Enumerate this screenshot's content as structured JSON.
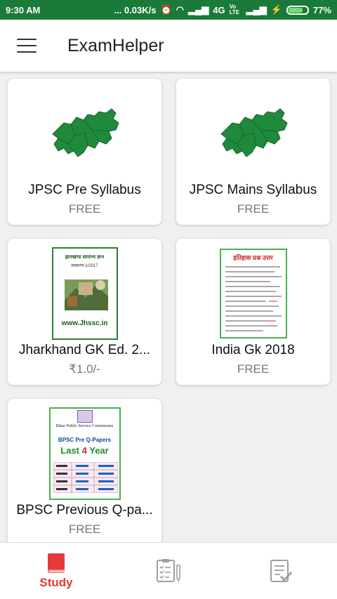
{
  "status_bar": {
    "time": "9:30 AM",
    "net_speed": "... 0.03K/s",
    "network": "4G",
    "volte": "Vo LTE",
    "battery_text": "77%",
    "battery_level": 0.77
  },
  "app_bar": {
    "title": "ExamHelper"
  },
  "cards": [
    {
      "title": "JPSC Pre Syllabus",
      "price": "FREE"
    },
    {
      "title": "JPSC Mains Syllabus",
      "price": "FREE"
    },
    {
      "title": "Jharkhand GK Ed. 2...",
      "price": "₹1.0/-"
    },
    {
      "title": "India Gk 2018",
      "price": "FREE"
    },
    {
      "title": "BPSC Previous Q-pa...",
      "price": "FREE"
    }
  ],
  "covers": {
    "jharkhand_gk": {
      "heading": "झारखण्ड सामान्य ज्ञान",
      "edition": "संस्करण-1/2017",
      "url": "www.Jhssc.in"
    },
    "india_gk": {
      "heading": "इतिहास प्रश्न उत्तर"
    },
    "bpsc": {
      "org": "Bihar Public Service Commission",
      "subtitle": "BPSC Pre Q-Papers",
      "headline_prefix": "Last ",
      "headline_number": "4",
      "headline_suffix": " Year"
    }
  },
  "bottom_nav": {
    "study_label": "Study"
  },
  "colors": {
    "accent": "#e53935",
    "status_bar": "#1b7a3a",
    "map_green": "#1f8a3c"
  }
}
